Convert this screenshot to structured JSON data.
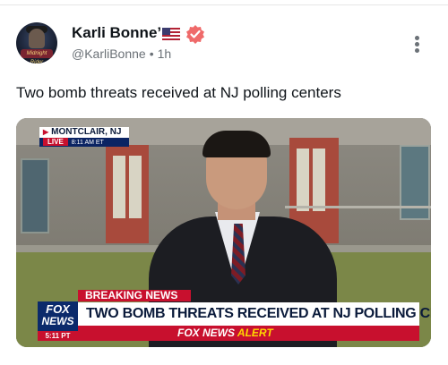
{
  "post": {
    "author_name": "Karli Bonne’",
    "handle": "@KarliBonne",
    "separator": "•",
    "time": "1h",
    "text": "Two bomb threats received at NJ polling centers",
    "avatar_caption": "Midnight Rider",
    "icons": {
      "flag": "us-flag-icon",
      "verified": "verified-badge-icon",
      "more": "more-options-icon"
    },
    "colors": {
      "verified": "#ef6a6a",
      "name": "#0f1419",
      "meta": "#6b7177"
    }
  },
  "media": {
    "location": "MONTCLAIR, NJ",
    "live_label": "LIVE",
    "live_time": "8:11 AM ET",
    "breaking_label": "BREAKING NEWS",
    "headline": "TWO BOMB THREATS RECEIVED AT NJ POLLING CENTERS",
    "logo_fox": "FOX",
    "logo_news": "NEWS",
    "logo_time": "5:11 PT",
    "alert_brand": "FOX NEWS",
    "alert_word": "ALERT",
    "colors": {
      "red": "#c8102e",
      "navy": "#0b2a6b",
      "yellow": "#ffd700"
    }
  }
}
